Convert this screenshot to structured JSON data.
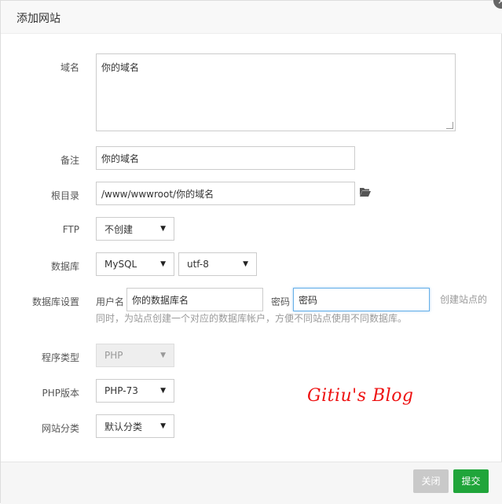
{
  "dialog": {
    "title": "添加网站",
    "close_icon": "close-icon"
  },
  "form": {
    "domain": {
      "label": "域名",
      "value": "你的域名"
    },
    "remark": {
      "label": "备注",
      "value": "你的域名"
    },
    "root": {
      "label": "根目录",
      "value": "/www/wwwroot/你的域名",
      "folder_icon": "folder-open-icon"
    },
    "ftp": {
      "label": "FTP",
      "selected": "不创建"
    },
    "database": {
      "label": "数据库",
      "type_selected": "MySQL",
      "charset_selected": "utf-8"
    },
    "db_settings": {
      "label": "数据库设置",
      "user_label": "用户名",
      "user_value": "你的数据库名",
      "pass_label": "密码",
      "pass_value": "密码",
      "hint_line1": "创建站点的",
      "hint_line2": "同时，为站点创建一个对应的数据库帐户，方便不同站点使用不同数据库。"
    },
    "program_type": {
      "label": "程序类型",
      "selected": "PHP"
    },
    "php_version": {
      "label": "PHP版本",
      "selected": "PHP-73"
    },
    "site_category": {
      "label": "网站分类",
      "selected": "默认分类"
    }
  },
  "footer": {
    "close_label": "关闭",
    "submit_label": "提交"
  },
  "watermark": "Gitiu's Blog"
}
